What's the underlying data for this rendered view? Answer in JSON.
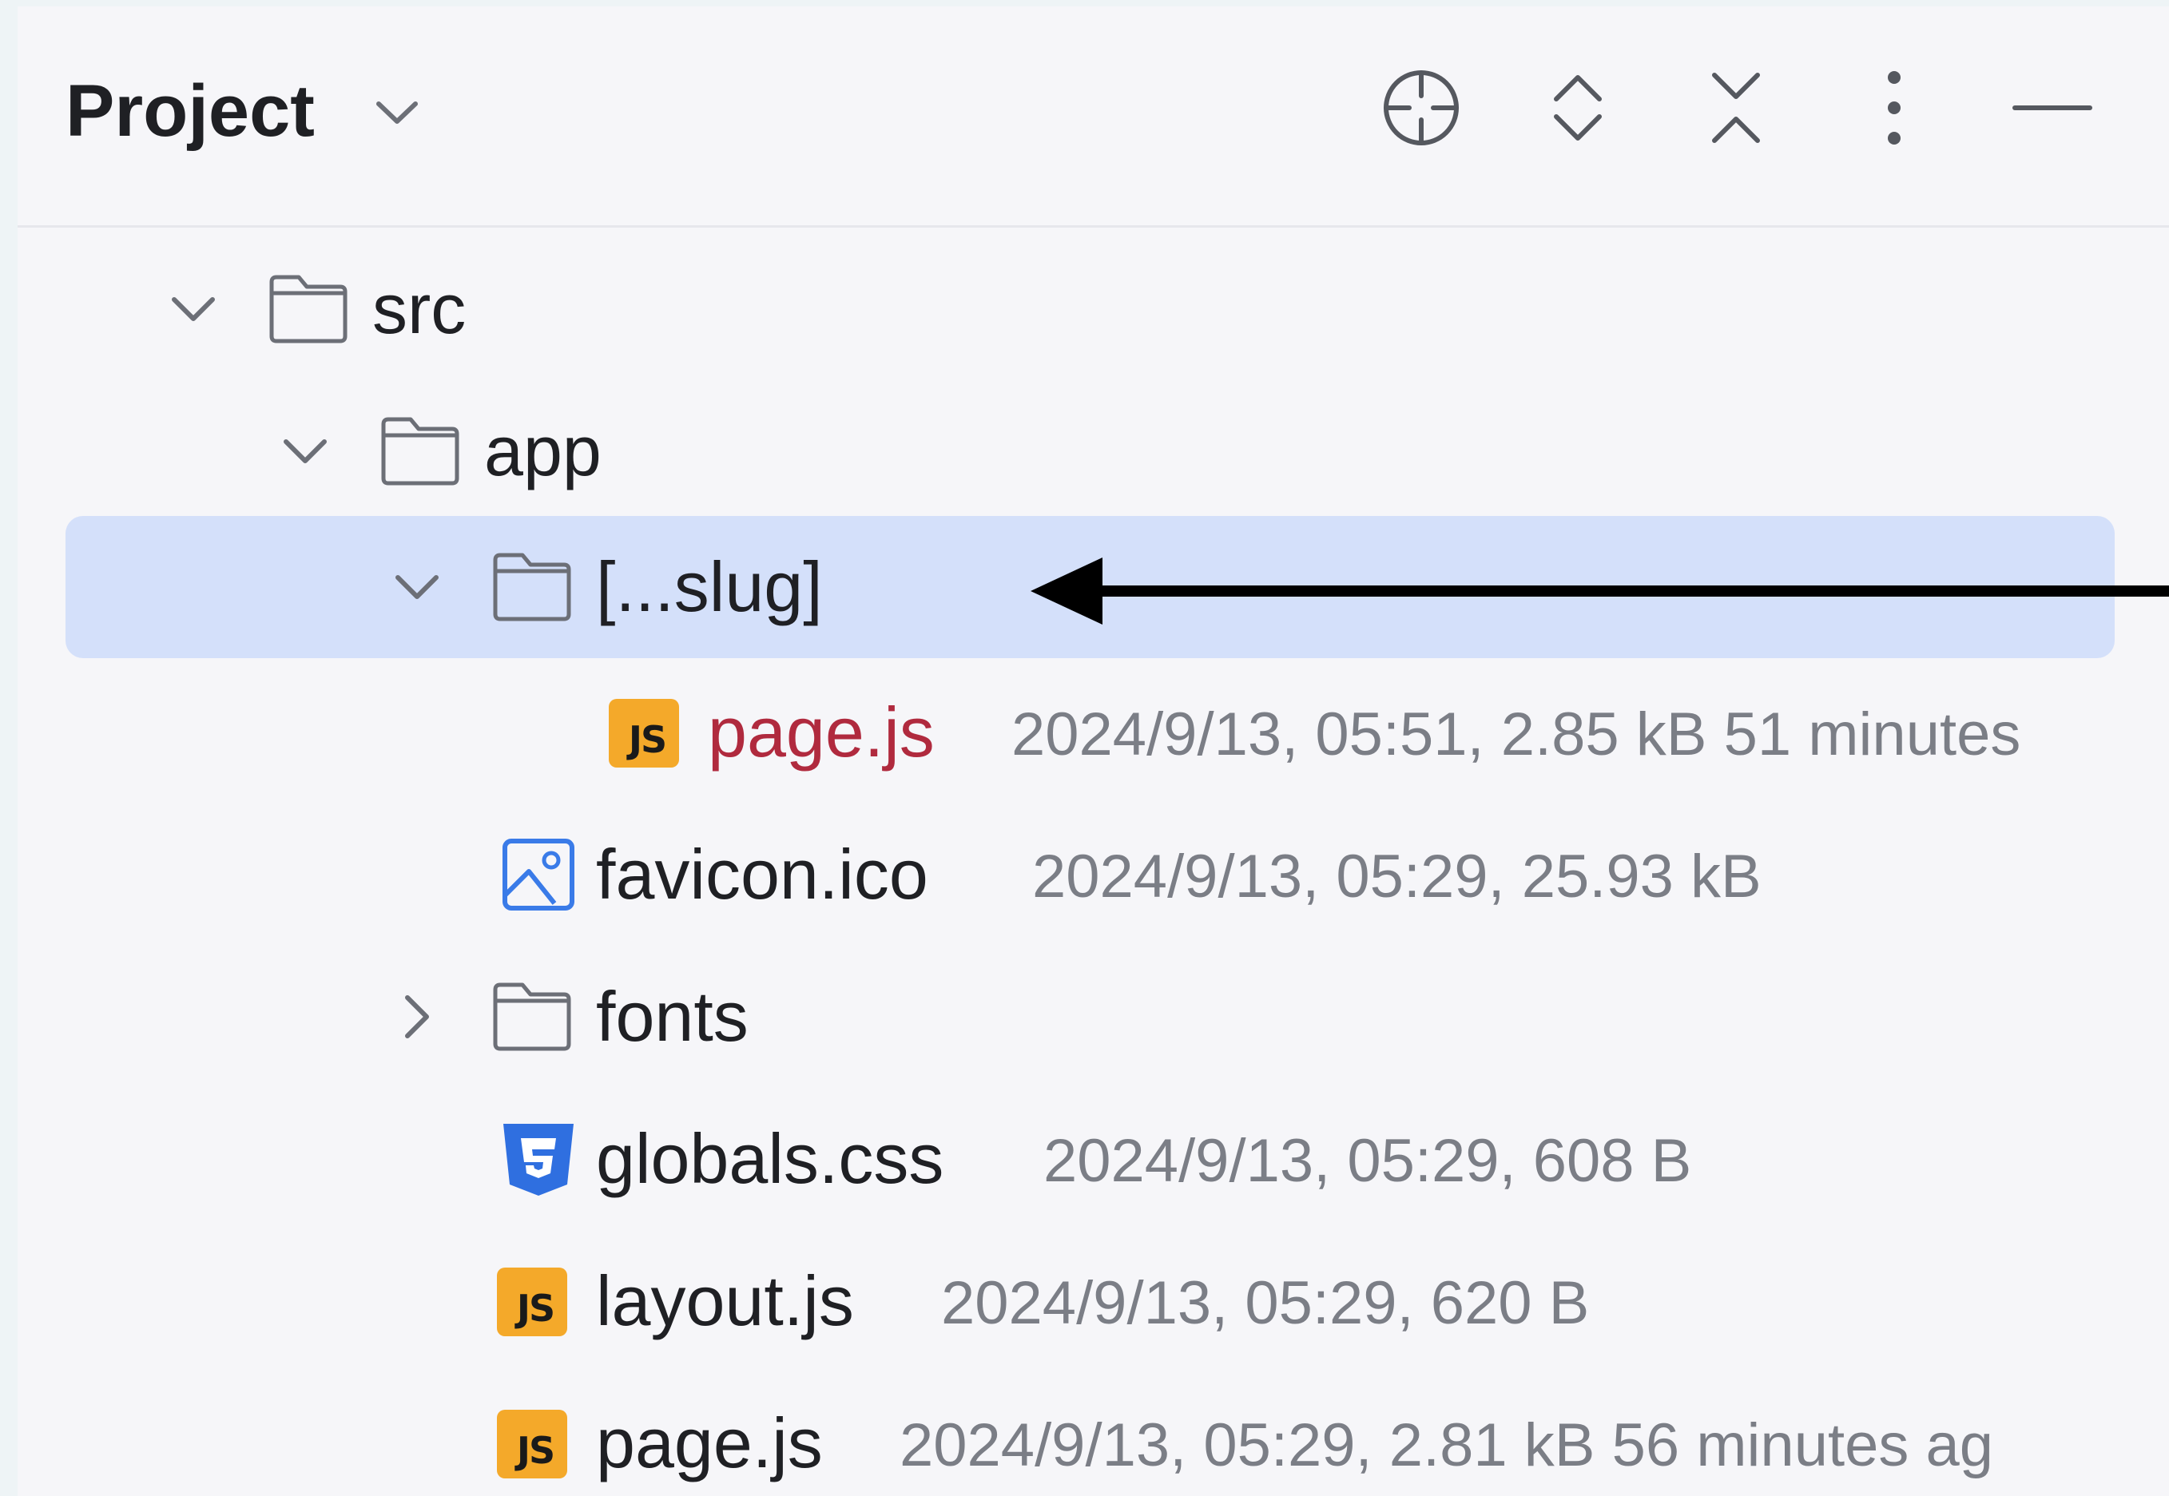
{
  "panel": {
    "title": "Project"
  },
  "toolbar": {
    "icons": [
      "locate-icon",
      "expand-all-icon",
      "collapse-all-icon",
      "more-options-icon",
      "minimize-icon"
    ]
  },
  "tree": [
    {
      "name": "src",
      "type": "folder",
      "expanded": true
    },
    {
      "name": "app",
      "type": "folder",
      "expanded": true
    },
    {
      "name": "[...slug]",
      "type": "folder",
      "expanded": true,
      "selected": true
    },
    {
      "name": "page.js",
      "type": "js",
      "meta": "2024/9/13, 05:51, 2.85 kB 51 minutes",
      "modified": true
    },
    {
      "name": "favicon.ico",
      "type": "image",
      "meta": "2024/9/13, 05:29, 25.93 kB"
    },
    {
      "name": "fonts",
      "type": "folder",
      "expanded": false
    },
    {
      "name": "globals.css",
      "type": "css",
      "meta": "2024/9/13, 05:29, 608 B"
    },
    {
      "name": "layout.js",
      "type": "js",
      "meta": "2024/9/13, 05:29, 620 B"
    },
    {
      "name": "page.js",
      "type": "js",
      "meta": "2024/9/13, 05:29, 2.81 kB 56 minutes ag"
    }
  ],
  "badges": {
    "js": "JS"
  },
  "colors": {
    "selection": "#d4e0fa",
    "modified_text": "#b02a3e",
    "js_badge": "#f4a92a",
    "css_icon": "#2f6fe0",
    "image_icon": "#3a7be8"
  }
}
